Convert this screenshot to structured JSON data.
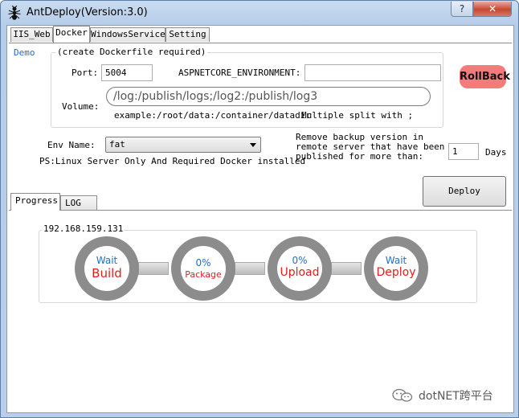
{
  "window": {
    "title": "AntDeploy(Version:3.0)",
    "help_label": "?",
    "close_label": "✕"
  },
  "tabs_top": [
    {
      "label": "IIS_Web"
    },
    {
      "label": "Docker"
    },
    {
      "label": "WindowsService"
    },
    {
      "label": "Setting"
    }
  ],
  "docker": {
    "demo_link": "Demo",
    "group_legend": "(create Dockerfile required)",
    "port_label": "Port:",
    "port_value": "5004",
    "aspnetcore_env_label": "ASPNETCORE_ENVIRONMENT:",
    "aspnetcore_env_value": "",
    "volume_label": "Volume:",
    "volume_value": "/log:/publish/logs;/log2:/publish/log3",
    "volume_hint_example": "example:/root/data:/container/datadir",
    "volume_hint_split": "Multiple split with ;",
    "rollback_label": "RollBack",
    "env_name_label": "Env Name:",
    "env_name_value": "fat",
    "ps_note": "PS:Linux Server Only And Required Docker installed",
    "backup_line1": "Remove backup version in",
    "backup_line2": "remote server that have been",
    "backup_line3": "published for more than:",
    "backup_days_value": "1",
    "days_label": "Days",
    "deploy_label": "Deploy"
  },
  "tabs_bottom": [
    {
      "label": "Progress"
    },
    {
      "label": "LOG"
    }
  ],
  "progress": {
    "server": "192.168.159.131",
    "steps": [
      {
        "top": "Wait",
        "bottom": "Build"
      },
      {
        "top": "0%",
        "bottom": "Package"
      },
      {
        "top": "0%",
        "bottom": "Upload"
      },
      {
        "top": "Wait",
        "bottom": "Deploy"
      }
    ]
  },
  "watermark": {
    "text": "dotNET跨平台"
  }
}
